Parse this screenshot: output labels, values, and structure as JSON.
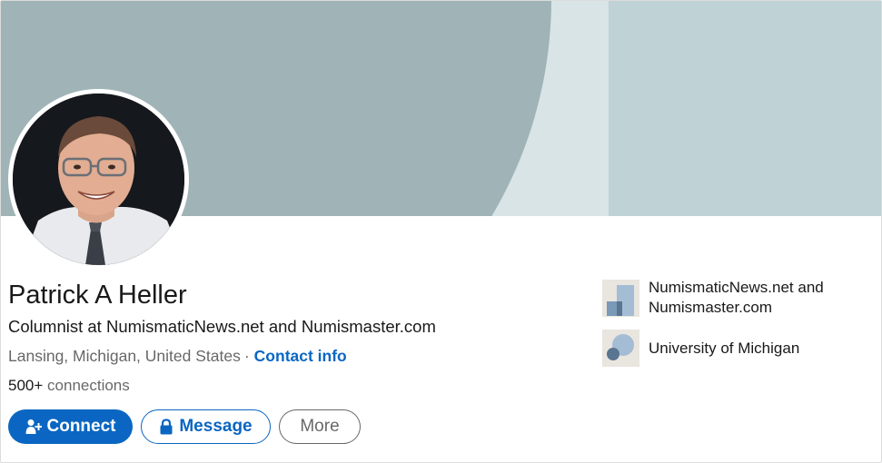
{
  "profile": {
    "name": "Patrick A Heller",
    "headline": "Columnist at NumismaticNews.net and Numismaster.com",
    "location": "Lansing, Michigan, United States",
    "separator": "·",
    "contact_info": "Contact info",
    "connections_count": "500+",
    "connections_label": "connections"
  },
  "actions": {
    "connect": "Connect",
    "message": "Message",
    "more": "More"
  },
  "sidebar": {
    "items": [
      {
        "label": "NumismaticNews.net and Numismaster.com",
        "icon": "company-logo-icon"
      },
      {
        "label": "University of Michigan",
        "icon": "school-logo-icon"
      }
    ]
  },
  "colors": {
    "brand": "#0a66c2",
    "banner_dark": "#a0b4b7",
    "banner_light": "#d9e4e7",
    "banner_panel": "#bfd2d6"
  }
}
